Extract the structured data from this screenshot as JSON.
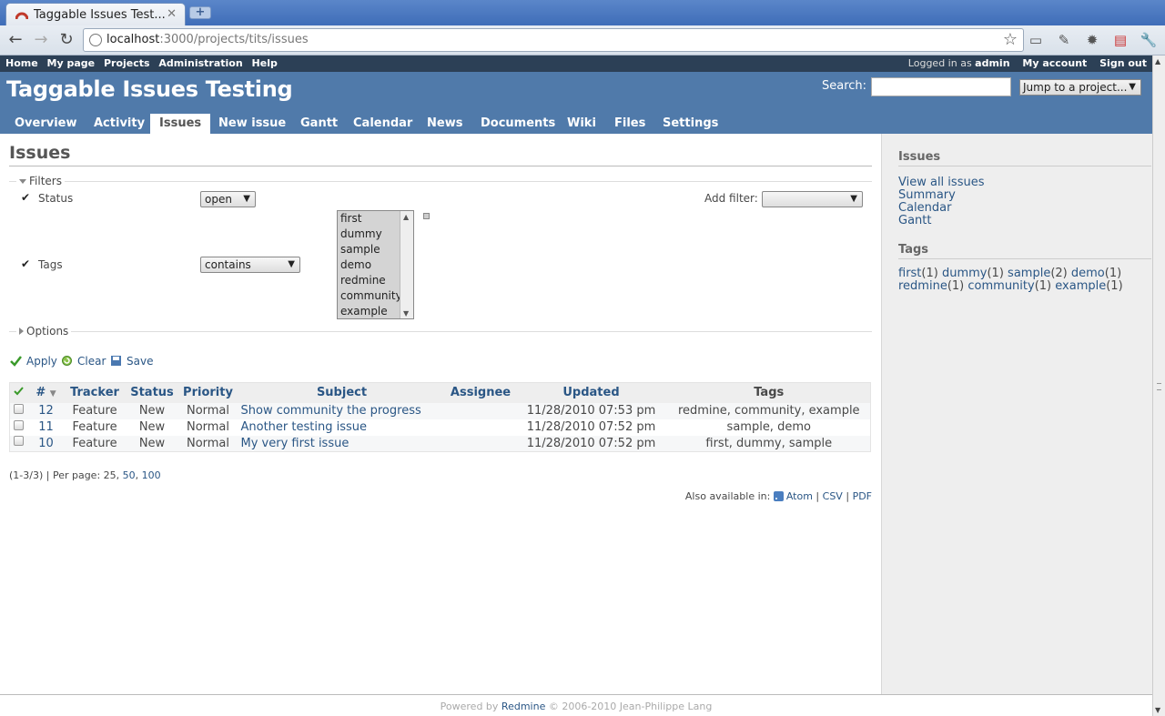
{
  "browser": {
    "tab_title": "Taggable Issues Test...",
    "url_host": "localhost",
    "url_path": ":3000/projects/tits/issues",
    "new_tab_label": "+"
  },
  "top_menu": {
    "left": [
      "Home",
      "My page",
      "Projects",
      "Administration",
      "Help"
    ],
    "logged_in_prefix": "Logged in as",
    "user": "admin",
    "my_account": "My account",
    "sign_out": "Sign out"
  },
  "header": {
    "title": "Taggable Issues Testing",
    "search_label": "Search:",
    "jump_label": "Jump to a project..."
  },
  "main_menu": [
    "Overview",
    "Activity",
    "Issues",
    "New issue",
    "Gantt",
    "Calendar",
    "News",
    "Documents",
    "Wiki",
    "Files",
    "Settings"
  ],
  "content": {
    "title": "Issues",
    "filters_legend": "Filters",
    "options_legend": "Options",
    "add_filter_label": "Add filter:",
    "filters": {
      "status_label": "Status",
      "status_value": "open",
      "tags_label": "Tags",
      "tags_operator": "contains",
      "tags_options": [
        "first",
        "dummy",
        "sample",
        "demo",
        "redmine",
        "community",
        "example"
      ]
    },
    "actions": {
      "apply": "Apply",
      "clear": "Clear",
      "save": "Save"
    },
    "columns": {
      "id": "#",
      "tracker": "Tracker",
      "status": "Status",
      "priority": "Priority",
      "subject": "Subject",
      "assignee": "Assignee",
      "updated": "Updated",
      "tags": "Tags"
    },
    "issues": [
      {
        "id": "12",
        "tracker": "Feature",
        "status": "New",
        "priority": "Normal",
        "subject": "Show community the progress",
        "assignee": "",
        "updated": "11/28/2010 07:53 pm",
        "tags": "redmine, community, example"
      },
      {
        "id": "11",
        "tracker": "Feature",
        "status": "New",
        "priority": "Normal",
        "subject": "Another testing issue",
        "assignee": "",
        "updated": "11/28/2010 07:52 pm",
        "tags": "sample, demo"
      },
      {
        "id": "10",
        "tracker": "Feature",
        "status": "New",
        "priority": "Normal",
        "subject": "My very first issue",
        "assignee": "",
        "updated": "11/28/2010 07:52 pm",
        "tags": "first, dummy, sample"
      }
    ],
    "pagination": {
      "summary": "(1-3/3) | Per page: 25,",
      "p50": "50",
      "sep": ",",
      "p100": "100"
    },
    "other_formats": {
      "label": "Also available in:",
      "atom": "Atom",
      "csv": "CSV",
      "pdf": "PDF",
      "sep": "|"
    }
  },
  "sidebar": {
    "issues_heading": "Issues",
    "links": [
      "View all issues",
      "Summary",
      "Calendar",
      "Gantt"
    ],
    "tags_heading": "Tags",
    "tags": [
      {
        "name": "first",
        "count": "(1)"
      },
      {
        "name": "dummy",
        "count": "(1)"
      },
      {
        "name": "sample",
        "count": "(2)"
      },
      {
        "name": "demo",
        "count": "(1)"
      },
      {
        "name": "redmine",
        "count": "(1)"
      },
      {
        "name": "community",
        "count": "(1)"
      },
      {
        "name": "example",
        "count": "(1)"
      }
    ]
  },
  "footer": {
    "powered_by": "Powered by",
    "redmine": "Redmine",
    "copyright": "© 2006-2010 Jean-Philippe Lang"
  },
  "colors": {
    "header_bg": "#507aaa",
    "top_menu_bg": "#2c4056",
    "link": "#2a5685"
  }
}
